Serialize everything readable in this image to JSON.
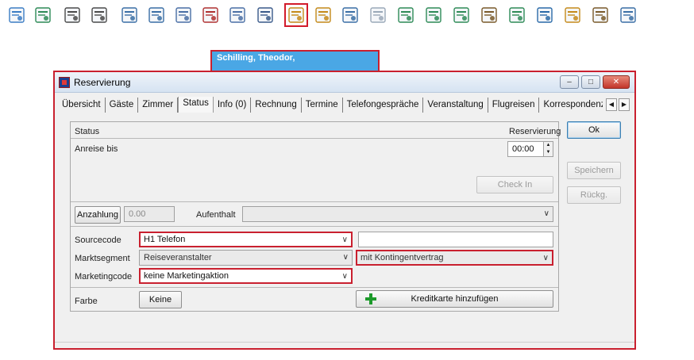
{
  "toolbar": {
    "icons": [
      {
        "name": "chart-icon",
        "color": "#3b7dc4"
      },
      {
        "name": "add-person-icon",
        "color": "#2e8b57"
      },
      {
        "name": "clock-icon",
        "color": "#4a4a4a"
      },
      {
        "name": "sea-clock-icon",
        "color": "#4a4a4a"
      },
      {
        "name": "list-form-icon",
        "color": "#3a6ea5"
      },
      {
        "name": "grid-form-icon",
        "color": "#3a6ea5"
      },
      {
        "name": "group-icon",
        "color": "#4a6fa5"
      },
      {
        "name": "person-alert-icon",
        "color": "#b03030"
      },
      {
        "name": "people-share-icon",
        "color": "#4a6fa5"
      },
      {
        "name": "printer-icon",
        "color": "#3a5a8a"
      },
      {
        "name": "document-search-icon",
        "color": "#c58a1a",
        "highlight": true
      },
      {
        "name": "lock-computer-icon",
        "color": "#c58a1a"
      },
      {
        "name": "edit-document-icon",
        "color": "#3a6ea5"
      },
      {
        "name": "document-icon",
        "color": "#9aa8b8"
      },
      {
        "name": "people-green-icon",
        "color": "#2e8b57"
      },
      {
        "name": "person-arrow-left-icon",
        "color": "#2e8b57"
      },
      {
        "name": "person-arrow-right-icon",
        "color": "#2e8b57"
      },
      {
        "name": "certificate-icon",
        "color": "#7a5a2a"
      },
      {
        "name": "recycle-bin-icon",
        "color": "#2e8b57"
      },
      {
        "name": "phone-icon",
        "color": "#2a6aa8"
      },
      {
        "name": "invoice-euro-icon",
        "color": "#c58a1a"
      },
      {
        "name": "receipt-search-icon",
        "color": "#7a5a2a"
      },
      {
        "name": "register-icon",
        "color": "#3a6ea5"
      }
    ]
  },
  "guest_tab": {
    "name": "Schilling, Theodor,"
  },
  "dialog": {
    "title": "Reservierung",
    "tabs": [
      "Übersicht",
      "Gäste",
      "Zimmer",
      "Status",
      "Info (0)",
      "Rechnung",
      "Termine",
      "Telefongespräche",
      "Veranstaltung",
      "Flugreisen",
      "Korrespondenz"
    ],
    "active_tab": "Status",
    "status_label": "Status",
    "reservierung_label": "Reservierung",
    "anreise_label": "Anreise bis",
    "anreise_time": "00:00",
    "checkin_label": "Check In",
    "anzahlung_label": "Anzahlung",
    "anzahlung_value": "0.00",
    "aufenthalt_label": "Aufenthalt",
    "sourcecode_label": "Sourcecode",
    "sourcecode_value": "H1 Telefon",
    "marktsegment_label": "Marktsegment",
    "marktsegment_value": "Reiseveranstalter",
    "marktsegment_detail": "mit Kontingentvertrag",
    "marketingcode_label": "Marketingcode",
    "marketingcode_value": "keine Marketingaktion",
    "farbe_label": "Farbe",
    "farbe_button": "Keine",
    "kreditkarte_button": "Kreditkarte hinzufügen",
    "ok_label": "Ok",
    "speichern_label": "Speichern",
    "rueckg_label": "Rückg."
  },
  "colors": {
    "highlight_red": "#c9202f",
    "guest_tab_blue": "#4aa7e5",
    "plus_green": "#1d9a2b"
  }
}
